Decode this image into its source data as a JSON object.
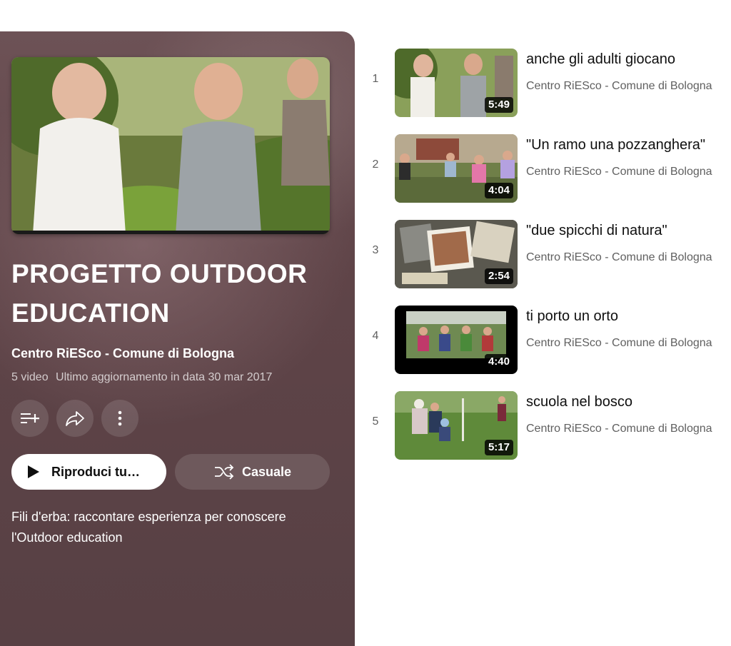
{
  "playlist": {
    "title": "PROGETTO OUTDOOR EDUCATION",
    "channel": "Centro RiESco - Comune di Bologna",
    "video_count": "5 video",
    "updated": "Ultimo aggiornamento in data 30 mar 2017",
    "play_all_label": "Riproduci tu…",
    "shuffle_label": "Casuale",
    "description": "Fili d'erba: raccontare esperienza per conoscere l'Outdoor education",
    "icons": [
      "add-to-queue-icon",
      "share-icon",
      "more-vert-icon",
      "play-icon",
      "shuffle-icon"
    ]
  },
  "videos": [
    {
      "index": "1",
      "title": "anche gli adulti giocano",
      "channel": "Centro RiESco - Comune di Bologna",
      "duration": "5:49"
    },
    {
      "index": "2",
      "title": "\"Un ramo una pozzanghera\"",
      "channel": "Centro RiESco - Comune di Bologna",
      "duration": "4:04"
    },
    {
      "index": "3",
      "title": "\"due spicchi di natura\"",
      "channel": "Centro RiESco - Comune di Bologna",
      "duration": "2:54"
    },
    {
      "index": "4",
      "title": "ti porto un orto",
      "channel": "Centro RiESco - Comune di Bologna",
      "duration": "4:40"
    },
    {
      "index": "5",
      "title": "scuola nel bosco",
      "channel": "Centro RiESco - Comune di Bologna",
      "duration": "5:17"
    }
  ],
  "colors": {
    "panel_bg": "#5f4448",
    "text_primary": "#0f0f0f",
    "text_secondary": "#606060",
    "duration_badge": "#000000"
  }
}
